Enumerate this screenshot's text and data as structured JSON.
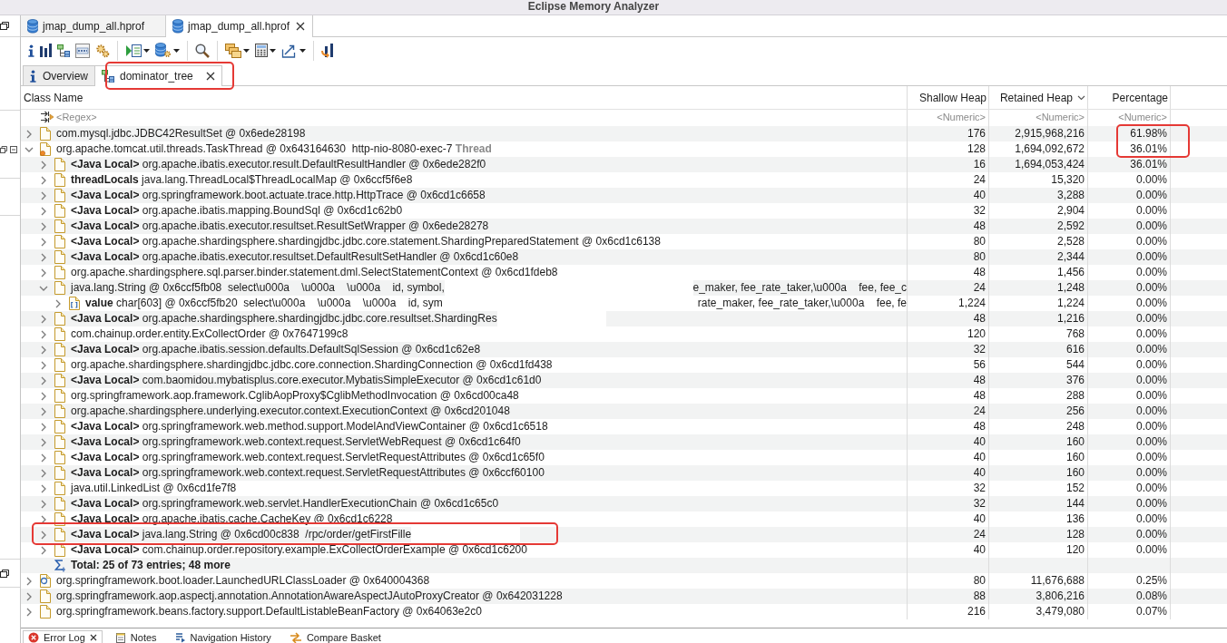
{
  "window": {
    "title": "Eclipse Memory Analyzer"
  },
  "editor_tabs": [
    {
      "label": "jmap_dump_all.hprof",
      "selected": false,
      "closable": false
    },
    {
      "label": "jmap_dump_all.hprof",
      "selected": true,
      "closable": true
    }
  ],
  "page_tabs": [
    {
      "kind": "overview",
      "label": "Overview",
      "selected": false,
      "closable": false
    },
    {
      "kind": "tree",
      "label": "dominator_tree",
      "selected": true,
      "closable": true,
      "annotated": true
    }
  ],
  "table": {
    "columns": [
      {
        "label": "Class Name",
        "sorted": false,
        "placeholder": "<Regex>"
      },
      {
        "label": "Shallow Heap",
        "sorted": false,
        "placeholder": "<Numeric>"
      },
      {
        "label": "Retained Heap",
        "sorted": true,
        "placeholder": "<Numeric>"
      },
      {
        "label": "Percentage",
        "sorted": false,
        "placeholder": "<Numeric>"
      }
    ],
    "rows": [
      {
        "kind": "object",
        "name": "com.mysql.jdbc.JDBC42ResultSet @ 0x6ede28198",
        "shallow": "176",
        "retained": "2,915,968,216",
        "percentage": "61.98%",
        "expanded": false,
        "percentage_annotated": true
      },
      {
        "kind": "thread",
        "name": "org.apache.tomcat.util.threads.TaskThread @ 0x643164630  http-nio-8080-exec-7",
        "suffix": "Thread",
        "shallow": "128",
        "retained": "1,694,092,672",
        "percentage": "36.01%",
        "expanded": true,
        "percentage_annotated": true,
        "children": [
          {
            "kind": "object",
            "prefix": "<Java Local>",
            "name": "org.apache.ibatis.executor.result.DefaultResultHandler @ 0x6ede282f0",
            "shallow": "16",
            "retained": "1,694,053,424",
            "percentage": "36.01%",
            "expanded": false
          },
          {
            "kind": "object",
            "prefix": "threadLocals",
            "name": "java.lang.ThreadLocal$ThreadLocalMap @ 0x6ccf5f6e8",
            "shallow": "24",
            "retained": "15,320",
            "percentage": "0.00%",
            "expanded": false
          },
          {
            "kind": "object",
            "prefix": "<Java Local>",
            "name": "org.springframework.boot.actuate.trace.http.HttpTrace @ 0x6cd1c6658",
            "shallow": "40",
            "retained": "3,288",
            "percentage": "0.00%",
            "expanded": false
          },
          {
            "kind": "object",
            "prefix": "<Java Local>",
            "name": "org.apache.ibatis.mapping.BoundSql @ 0x6cd1c62b0",
            "shallow": "32",
            "retained": "2,904",
            "percentage": "0.00%",
            "expanded": false
          },
          {
            "kind": "object",
            "prefix": "<Java Local>",
            "name": "org.apache.ibatis.executor.resultset.ResultSetWrapper @ 0x6ede28278",
            "shallow": "48",
            "retained": "2,592",
            "percentage": "0.00%",
            "expanded": false
          },
          {
            "kind": "object",
            "prefix": "<Java Local>",
            "name": "org.apache.shardingsphere.shardingjdbc.jdbc.core.statement.ShardingPreparedStatement @ 0x6cd1c6138",
            "shallow": "80",
            "retained": "2,528",
            "percentage": "0.00%",
            "expanded": false
          },
          {
            "kind": "object",
            "prefix": "<Java Local>",
            "name": "org.apache.ibatis.executor.resultset.DefaultResultSetHandler @ 0x6cd1c60e8",
            "shallow": "80",
            "retained": "2,344",
            "percentage": "0.00%",
            "expanded": false
          },
          {
            "kind": "object",
            "name": "org.apache.shardingsphere.sql.parser.binder.statement.dml.SelectStatementContext @ 0x6cd1fdeb8",
            "shallow": "48",
            "retained": "1,456",
            "percentage": "0.00%",
            "expanded": false
          },
          {
            "kind": "object",
            "name": "java.lang.String @ 0x6ccf5fb08  select\\u000a    \\u000a    \\u000a    id, symbol,",
            "redacted": true,
            "continuation": "e_maker, fee_rate_taker,\\u000a    fee, fee_c",
            "shallow": "24",
            "retained": "1,248",
            "percentage": "0.00%",
            "expanded": true,
            "children": [
              {
                "kind": "array",
                "prefix": "value",
                "name": "char[603] @ 0x6ccf5fb20  select\\u000a    \\u000a    \\u000a    id, sym",
                "redacted": true,
                "continuation": "rate_maker, fee_rate_taker,\\u000a    fee, fe",
                "shallow": "1,224",
                "retained": "1,224",
                "percentage": "0.00%",
                "expanded": false
              }
            ]
          },
          {
            "kind": "object",
            "prefix": "<Java Local>",
            "name": "org.apache.shardingsphere.shardingjdbc.jdbc.core.resultset.ShardingRes",
            "redacted": true,
            "shallow": "48",
            "retained": "1,216",
            "percentage": "0.00%",
            "expanded": false
          },
          {
            "kind": "object",
            "name": "com.chainup.order.entity.ExCollectOrder @ 0x7647199c8",
            "shallow": "120",
            "retained": "768",
            "percentage": "0.00%",
            "expanded": false
          },
          {
            "kind": "object",
            "prefix": "<Java Local>",
            "name": "org.apache.ibatis.session.defaults.DefaultSqlSession @ 0x6cd1c62e8",
            "shallow": "32",
            "retained": "616",
            "percentage": "0.00%",
            "expanded": false
          },
          {
            "kind": "object",
            "name": "org.apache.shardingsphere.shardingjdbc.jdbc.core.connection.ShardingConnection @ 0x6cd1fd438",
            "shallow": "56",
            "retained": "544",
            "percentage": "0.00%",
            "expanded": false
          },
          {
            "kind": "object",
            "prefix": "<Java Local>",
            "name": "com.baomidou.mybatisplus.core.executor.MybatisSimpleExecutor @ 0x6cd1c61d0",
            "shallow": "48",
            "retained": "376",
            "percentage": "0.00%",
            "expanded": false
          },
          {
            "kind": "object",
            "name": "org.springframework.aop.framework.CglibAopProxy$CglibMethodInvocation @ 0x6cd00ca48",
            "shallow": "48",
            "retained": "288",
            "percentage": "0.00%",
            "expanded": false
          },
          {
            "kind": "object",
            "name": "org.apache.shardingsphere.underlying.executor.context.ExecutionContext @ 0x6cd201048",
            "shallow": "24",
            "retained": "256",
            "percentage": "0.00%",
            "expanded": false
          },
          {
            "kind": "object",
            "prefix": "<Java Local>",
            "name": "org.springframework.web.method.support.ModelAndViewContainer @ 0x6cd1c6518",
            "shallow": "48",
            "retained": "248",
            "percentage": "0.00%",
            "expanded": false
          },
          {
            "kind": "object",
            "prefix": "<Java Local>",
            "name": "org.springframework.web.context.request.ServletWebRequest @ 0x6cd1c64f0",
            "shallow": "40",
            "retained": "160",
            "percentage": "0.00%",
            "expanded": false
          },
          {
            "kind": "object",
            "prefix": "<Java Local>",
            "name": "org.springframework.web.context.request.ServletRequestAttributes @ 0x6cd1c65f0",
            "shallow": "40",
            "retained": "160",
            "percentage": "0.00%",
            "expanded": false
          },
          {
            "kind": "object",
            "prefix": "<Java Local>",
            "name": "org.springframework.web.context.request.ServletRequestAttributes @ 0x6ccf60100",
            "shallow": "40",
            "retained": "160",
            "percentage": "0.00%",
            "expanded": false
          },
          {
            "kind": "object",
            "name": "java.util.LinkedList @ 0x6cd1fe7f8",
            "shallow": "32",
            "retained": "152",
            "percentage": "0.00%",
            "expanded": false
          },
          {
            "kind": "object",
            "prefix": "<Java Local>",
            "name": "org.springframework.web.servlet.HandlerExecutionChain @ 0x6cd1c65c0",
            "shallow": "32",
            "retained": "144",
            "percentage": "0.00%",
            "expanded": false
          },
          {
            "kind": "object",
            "prefix": "<Java Local>",
            "name": "org.apache.ibatis.cache.CacheKey @ 0x6cd1c6228",
            "shallow": "40",
            "retained": "136",
            "percentage": "0.00%",
            "expanded": false
          },
          {
            "kind": "object",
            "prefix": "<Java Local>",
            "name": "java.lang.String @ 0x6cd00c838  /rpc/order/getFirstFille",
            "redacted": true,
            "shallow": "24",
            "retained": "128",
            "percentage": "0.00%",
            "expanded": false,
            "name_annotated": true
          },
          {
            "kind": "object",
            "prefix": "<Java Local>",
            "name": "com.chainup.order.repository.example.ExCollectOrderExample @ 0x6cd1c6200",
            "shallow": "40",
            "retained": "120",
            "percentage": "0.00%",
            "expanded": false
          },
          {
            "kind": "total",
            "name": "Total: 25 of 73 entries; 48 more"
          }
        ]
      },
      {
        "kind": "classloader",
        "name": "org.springframework.boot.loader.LaunchedURLClassLoader @ 0x640004368",
        "shallow": "80",
        "retained": "11,676,688",
        "percentage": "0.25%",
        "expanded": false
      },
      {
        "kind": "object",
        "name": "org.springframework.aop.aspectj.annotation.AnnotationAwareAspectJAutoProxyCreator @ 0x642031228",
        "shallow": "88",
        "retained": "3,806,216",
        "percentage": "0.08%",
        "expanded": false
      },
      {
        "kind": "object",
        "name": "org.springframework.beans.factory.support.DefaultListableBeanFactory @ 0x64063e2c0",
        "shallow": "216",
        "retained": "3,479,080",
        "percentage": "0.07%",
        "expanded": false
      }
    ]
  },
  "view_tabs": [
    {
      "kind": "error",
      "label": "Error Log",
      "selected": true,
      "closable": true
    },
    {
      "kind": "notes",
      "label": "Notes",
      "selected": false,
      "closable": false
    },
    {
      "kind": "history",
      "label": "Navigation History",
      "selected": false,
      "closable": false
    },
    {
      "kind": "compare",
      "label": "Compare Basket",
      "selected": false,
      "closable": false
    }
  ]
}
